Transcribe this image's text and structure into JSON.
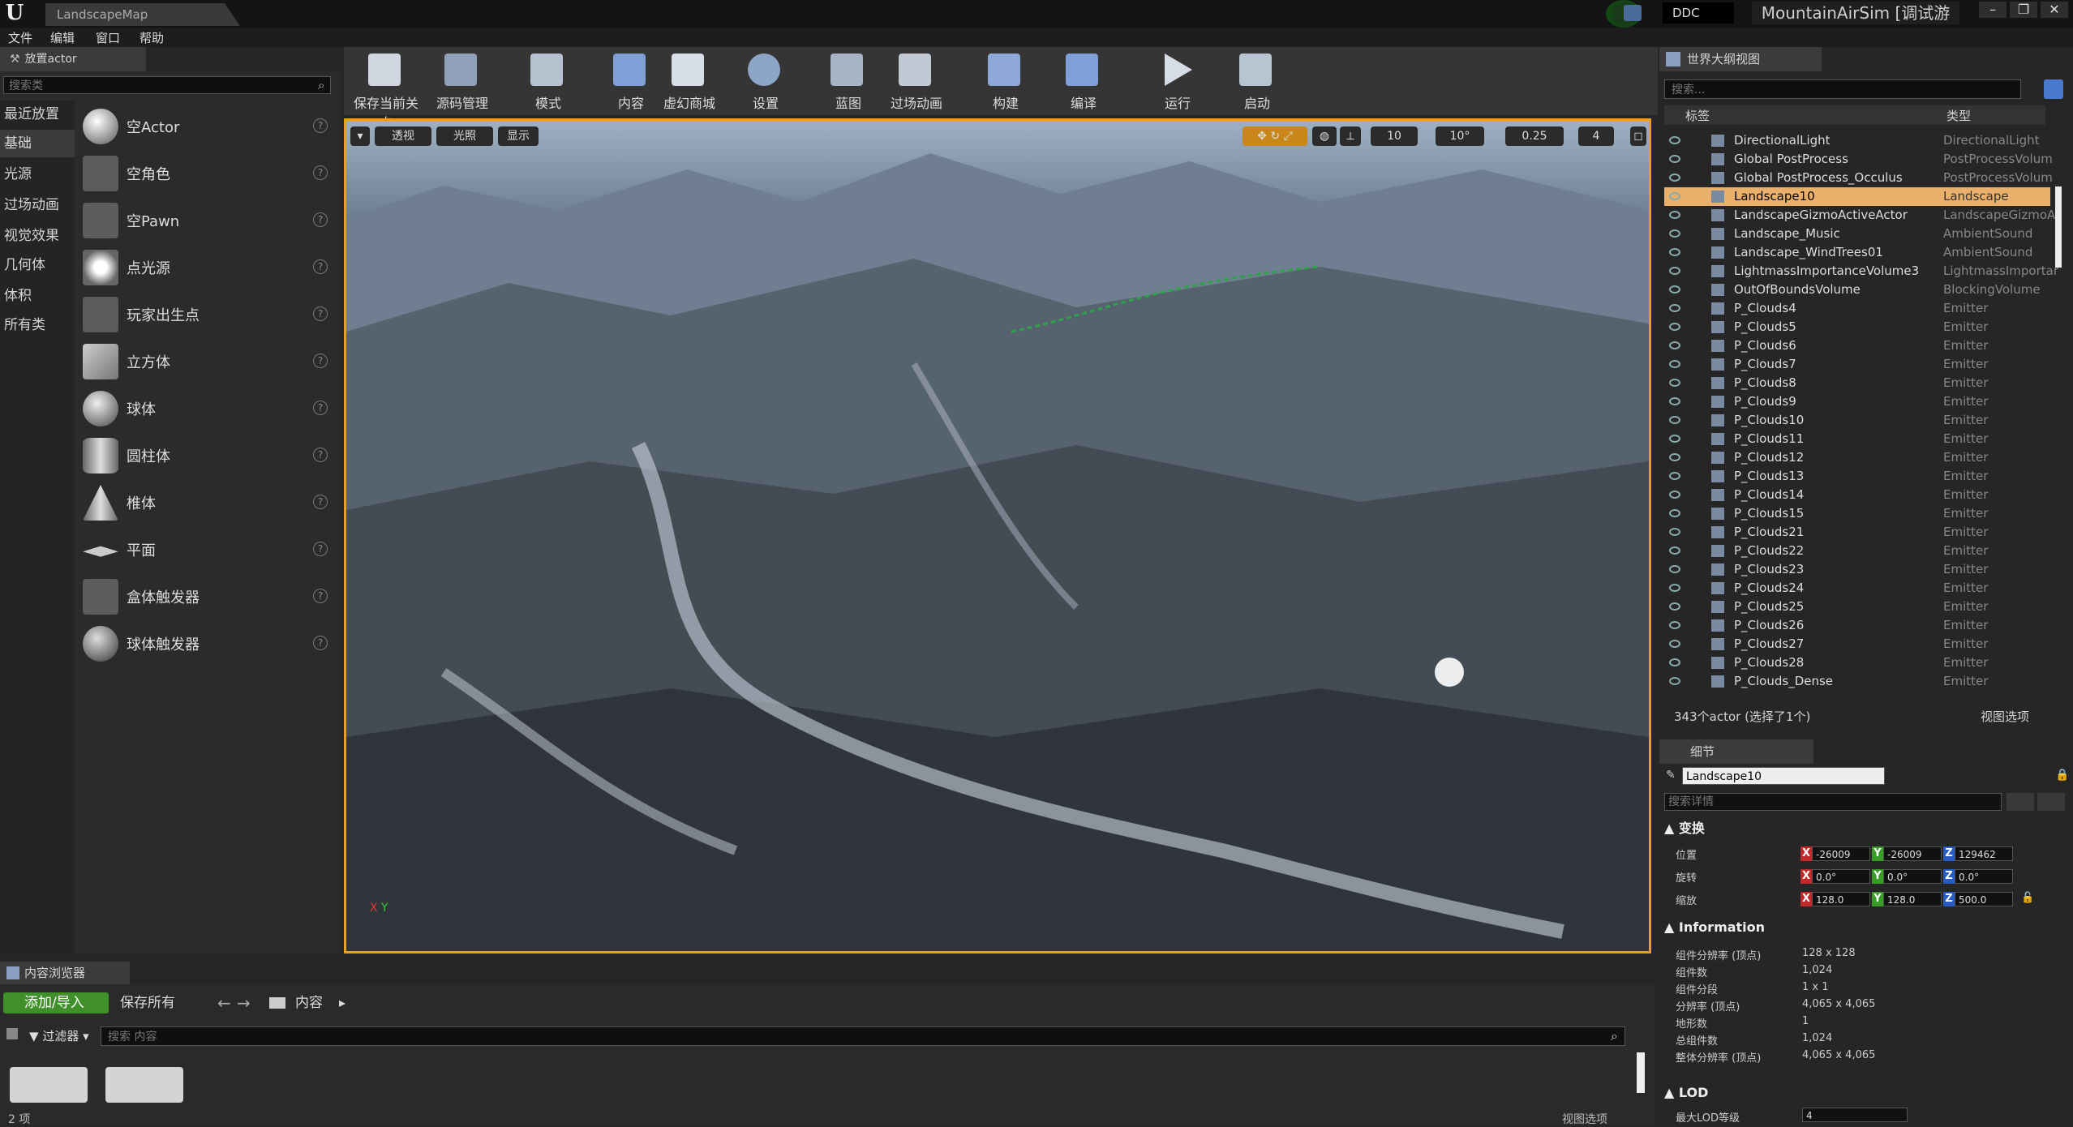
{
  "titlebar": {
    "doc_tab": "LandscapeMap",
    "ddc": "DDC",
    "project": "MountainAirSim [调试游戏]"
  },
  "menu": [
    "文件",
    "编辑",
    "窗口",
    "帮助"
  ],
  "place_actor": {
    "tab_label": "放置actor",
    "search_placeholder": "搜索类",
    "categories": [
      "最近放置",
      "基础",
      "光源",
      "过场动画",
      "视觉效果",
      "几何体",
      "体积",
      "所有类"
    ],
    "items": [
      "空Actor",
      "空角色",
      "空Pawn",
      "点光源",
      "玩家出生点",
      "立方体",
      "球体",
      "圆柱体",
      "椎体",
      "平面",
      "盒体触发器",
      "球体触发器"
    ]
  },
  "toolbar": [
    "保存当前关卡",
    "源码管理",
    "模式",
    "内容",
    "虚幻商城",
    "设置",
    "蓝图",
    "过场动画",
    "构建",
    "编译",
    "运行",
    "启动"
  ],
  "viewport": {
    "perspective": "透视",
    "lighting": "光照",
    "show": "显示",
    "grid_snap": "10",
    "rot_snap": "10°",
    "scale_snap": "0.25",
    "camera_speed": "4"
  },
  "outliner": {
    "tab_label": "世界大纲视图",
    "search_placeholder": "搜索...",
    "col_label": "标签",
    "col_type": "类型",
    "rows": [
      {
        "name": "DirectionalLight",
        "type": "DirectionalLight"
      },
      {
        "name": "Global PostProcess",
        "type": "PostProcessVolum"
      },
      {
        "name": "Global PostProcess_Occulus",
        "type": "PostProcessVolum"
      },
      {
        "name": "Landscape10",
        "type": "Landscape"
      },
      {
        "name": "LandscapeGizmoActiveActor",
        "type": "LandscapeGizmoA"
      },
      {
        "name": "Landscape_Music",
        "type": "AmbientSound"
      },
      {
        "name": "Landscape_WindTrees01",
        "type": "AmbientSound"
      },
      {
        "name": "LightmassImportanceVolume3",
        "type": "LightmassImportar"
      },
      {
        "name": "OutOfBoundsVolume",
        "type": "BlockingVolume"
      },
      {
        "name": "P_Clouds4",
        "type": "Emitter"
      },
      {
        "name": "P_Clouds5",
        "type": "Emitter"
      },
      {
        "name": "P_Clouds6",
        "type": "Emitter"
      },
      {
        "name": "P_Clouds7",
        "type": "Emitter"
      },
      {
        "name": "P_Clouds8",
        "type": "Emitter"
      },
      {
        "name": "P_Clouds9",
        "type": "Emitter"
      },
      {
        "name": "P_Clouds10",
        "type": "Emitter"
      },
      {
        "name": "P_Clouds11",
        "type": "Emitter"
      },
      {
        "name": "P_Clouds12",
        "type": "Emitter"
      },
      {
        "name": "P_Clouds13",
        "type": "Emitter"
      },
      {
        "name": "P_Clouds14",
        "type": "Emitter"
      },
      {
        "name": "P_Clouds15",
        "type": "Emitter"
      },
      {
        "name": "P_Clouds21",
        "type": "Emitter"
      },
      {
        "name": "P_Clouds22",
        "type": "Emitter"
      },
      {
        "name": "P_Clouds23",
        "type": "Emitter"
      },
      {
        "name": "P_Clouds24",
        "type": "Emitter"
      },
      {
        "name": "P_Clouds25",
        "type": "Emitter"
      },
      {
        "name": "P_Clouds26",
        "type": "Emitter"
      },
      {
        "name": "P_Clouds27",
        "type": "Emitter"
      },
      {
        "name": "P_Clouds28",
        "type": "Emitter"
      },
      {
        "name": "P_Clouds_Dense",
        "type": "Emitter"
      }
    ],
    "selected_index": 3,
    "footer": "343个actor (选择了1个)",
    "view_options": "视图选项"
  },
  "details": {
    "tab_label": "细节",
    "object_name": "Landscape10",
    "search_placeholder": "搜索详情",
    "transform_section": "变换",
    "location_label": "位置",
    "rotation_label": "旋转",
    "scale_label": "缩放",
    "location": {
      "x": "-26009",
      "y": "-26009",
      "z": "129462"
    },
    "rotation": {
      "x": "0.0°",
      "y": "0.0°",
      "z": "0.0°"
    },
    "scale": {
      "x": "128.0",
      "y": "128.0",
      "z": "500.0"
    },
    "info_section": "Information",
    "info": [
      {
        "label": "组件分辨率 (顶点)",
        "value": "128 x 128"
      },
      {
        "label": "组件数",
        "value": "1,024"
      },
      {
        "label": "组件分段",
        "value": "1 x 1"
      },
      {
        "label": "分辨率 (顶点)",
        "value": "4,065 x 4,065"
      },
      {
        "label": "地形数",
        "value": "1"
      },
      {
        "label": "总组件数",
        "value": "1,024"
      },
      {
        "label": "整体分辨率 (顶点)",
        "value": "4,065 x 4,065"
      }
    ],
    "lod_section": "LOD",
    "lod_label": "最大LOD等级",
    "lod_value": "4"
  },
  "content_browser": {
    "tab_label": "内容浏览器",
    "add_import": "添加/导入",
    "save_all": "保存所有",
    "path_root": "内容",
    "filters": "过滤器",
    "search_placeholder": "搜索 内容",
    "item_count": "2 项",
    "view_options": "视图选项"
  }
}
